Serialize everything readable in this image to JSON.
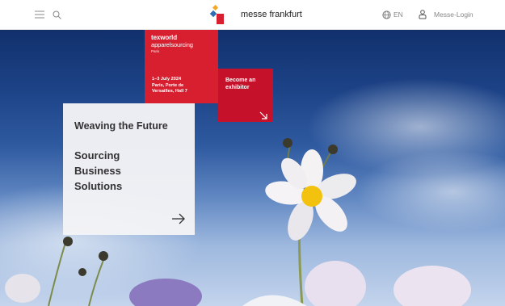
{
  "header": {
    "brand_name": "messe frankfurt",
    "language": "EN",
    "login_label": "Messe-Login",
    "icons": [
      "menu-icon",
      "search-icon",
      "globe-icon",
      "user-icon"
    ]
  },
  "event": {
    "title_line1": "texworld",
    "title_line2": "apparelsourcing",
    "city_tag": "Paris",
    "date": "1–3 July 2024",
    "venue_line1": "Paris, Porte de",
    "venue_line2": "Versailles, Hall 7"
  },
  "exhibitor": {
    "label_line1": "Become an",
    "label_line2": "exhibitor"
  },
  "feature": {
    "tagline": "Weaving the Future",
    "headline_line1": "Sourcing",
    "headline_line2": "Business",
    "headline_line3": "Solutions"
  },
  "colors": {
    "accent_red": "#d71f30",
    "accent_red_dark": "#c5112a",
    "sky_blue": "#1d4387"
  }
}
